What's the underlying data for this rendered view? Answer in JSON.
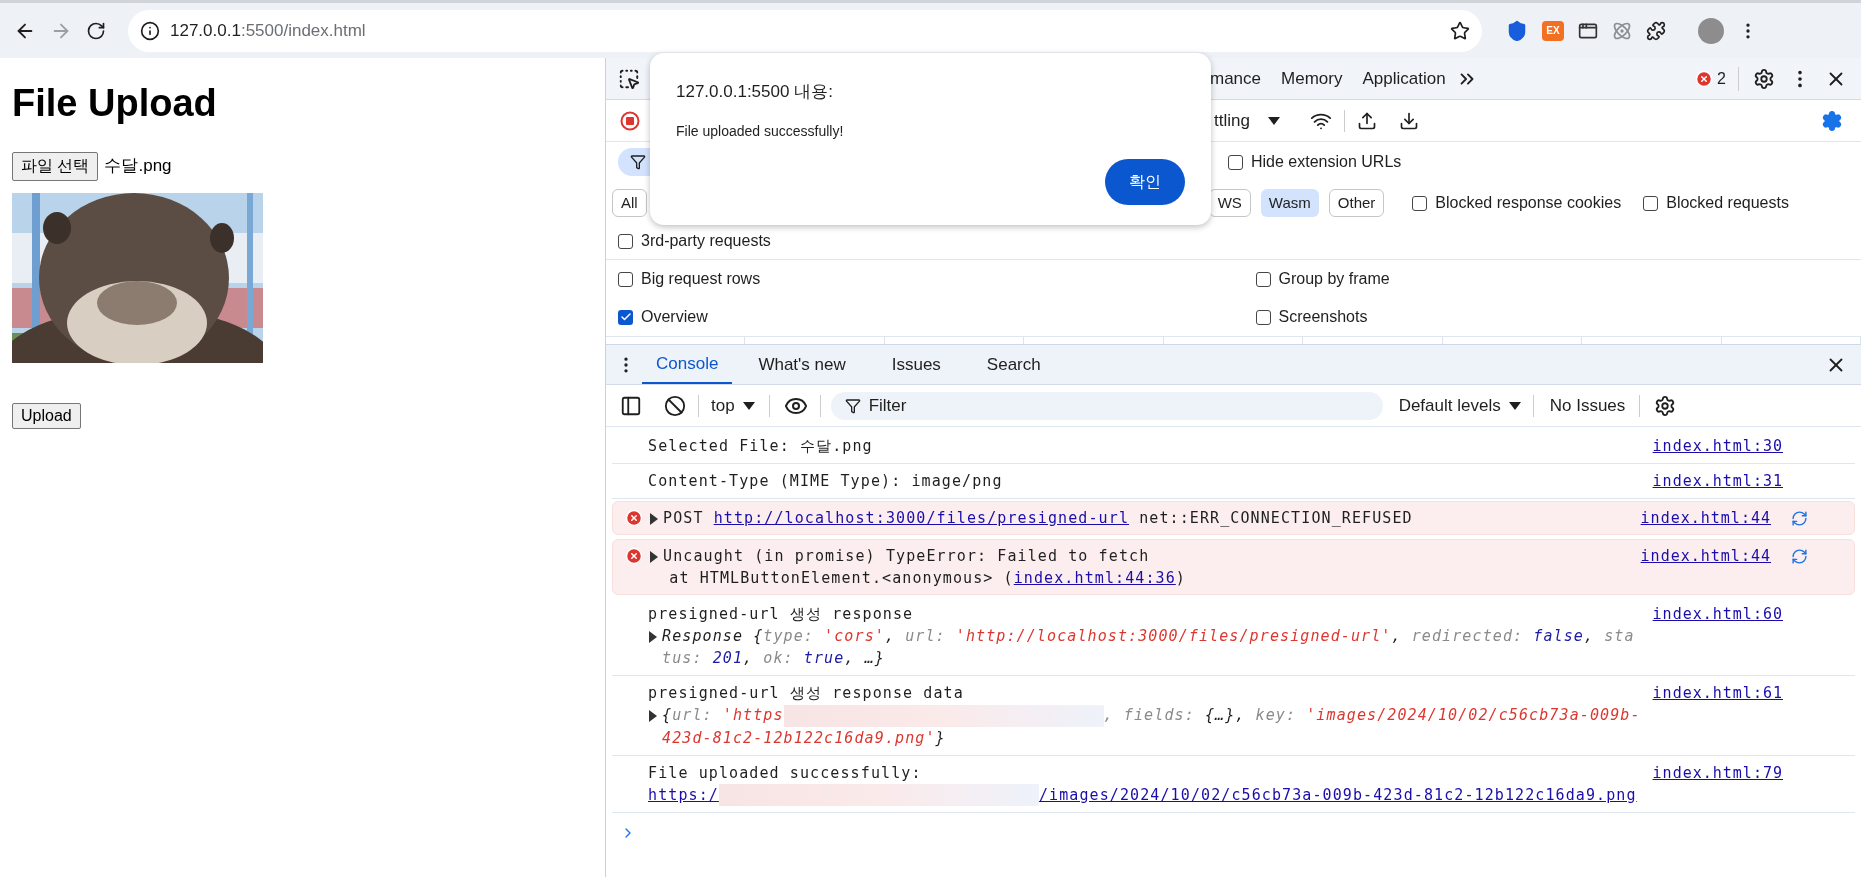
{
  "browser": {
    "url_host": "127.0.0.1",
    "url_path": ":5500/index.html",
    "forward_disabled": true,
    "bookmarked": false,
    "extension_badge": "EX"
  },
  "page": {
    "heading": "File Upload",
    "file_button": "파일 선택",
    "file_name": "수달.png",
    "upload_button": "Upload"
  },
  "dialog": {
    "title": "127.0.0.1:5500 내용:",
    "message": "File uploaded successfully!",
    "button": "확인"
  },
  "devtools": {
    "tabs": [
      "mance",
      "Memory",
      "Application"
    ],
    "error_count": "2",
    "throttling": "ttling",
    "hide_extension_urls": {
      "label": "Hide extension URLs",
      "checked": false
    },
    "type_filters": [
      {
        "label": "All",
        "selected": false
      },
      {
        "label": "WS",
        "selected": false
      },
      {
        "label": "Wasm",
        "selected": true
      },
      {
        "label": "Other",
        "selected": false
      }
    ],
    "type_options": [
      {
        "label": "Blocked response cookies",
        "checked": false
      },
      {
        "label": "Blocked requests",
        "checked": false
      }
    ],
    "third_party": {
      "label": "3rd-party requests",
      "checked": false
    },
    "settings": [
      {
        "label": "Big request rows",
        "checked": false
      },
      {
        "label": "Group by frame",
        "checked": false
      },
      {
        "label": "Overview",
        "checked": true
      },
      {
        "label": "Screenshots",
        "checked": false
      }
    ],
    "drawer_tabs": [
      {
        "label": "Console",
        "selected": true
      },
      {
        "label": "What's new",
        "selected": false
      },
      {
        "label": "Issues",
        "selected": false
      },
      {
        "label": "Search",
        "selected": false
      }
    ],
    "console_toolbar": {
      "context": "top",
      "filter_placeholder": "Filter",
      "levels": "Default levels",
      "issues": "No Issues"
    },
    "messages": [
      {
        "kind": "log",
        "source": "index.html:30",
        "lines": [
          {
            "expandable": false,
            "segments": [
              {
                "kind": "plain",
                "text": "Selected File: 수달.png"
              }
            ]
          }
        ]
      },
      {
        "kind": "log",
        "source": "index.html:31",
        "lines": [
          {
            "expandable": false,
            "segments": [
              {
                "kind": "plain",
                "text": "Content-Type (MIME Type): image/png"
              }
            ]
          }
        ]
      },
      {
        "kind": "error",
        "source": "index.html:44",
        "lines": [
          {
            "expandable": true,
            "segments": [
              {
                "kind": "plain",
                "text": "POST "
              },
              {
                "kind": "link",
                "text": "http://localhost:3000/files/presigned-url"
              },
              {
                "kind": "plain",
                "text": " net::ERR_CONNECTION_REFUSED"
              }
            ]
          }
        ]
      },
      {
        "kind": "error",
        "source": "index.html:44",
        "lines": [
          {
            "expandable": true,
            "segments": [
              {
                "kind": "plain",
                "text": "Uncaught (in promise) TypeError: Failed to fetch"
              }
            ]
          },
          {
            "expandable": false,
            "segments": [
              {
                "kind": "plain",
                "text": "  at HTMLButtonElement.<anonymous> ("
              },
              {
                "kind": "link",
                "text": "index.html:44:36"
              },
              {
                "kind": "plain",
                "text": ")"
              }
            ]
          }
        ]
      },
      {
        "kind": "log",
        "source": "index.html:60",
        "lines": [
          {
            "expandable": false,
            "segments": [
              {
                "kind": "plain",
                "text": "presigned-url 생성 response"
              }
            ]
          },
          {
            "expandable": true,
            "segments": [
              {
                "kind": "obj",
                "text": "Response {"
              },
              {
                "kind": "key",
                "text": "type: "
              },
              {
                "kind": "str",
                "text": "'cors'"
              },
              {
                "kind": "obj",
                "text": ", "
              },
              {
                "kind": "key",
                "text": "url: "
              },
              {
                "kind": "str",
                "text": "'http://localhost:3000/files/presigned-url'"
              },
              {
                "kind": "obj",
                "text": ", "
              },
              {
                "kind": "key",
                "text": "redirected: "
              },
              {
                "kind": "val",
                "text": "false"
              },
              {
                "kind": "obj",
                "text": ", "
              },
              {
                "kind": "key",
                "text": "status: "
              },
              {
                "kind": "val",
                "text": "201"
              },
              {
                "kind": "obj",
                "text": ", "
              },
              {
                "kind": "key",
                "text": "ok: "
              },
              {
                "kind": "val",
                "text": "true"
              },
              {
                "kind": "obj",
                "text": ", …}"
              }
            ]
          }
        ]
      },
      {
        "kind": "log",
        "source": "index.html:61",
        "lines": [
          {
            "expandable": false,
            "segments": [
              {
                "kind": "plain",
                "text": "presigned-url 생성 response data"
              }
            ]
          },
          {
            "expandable": true,
            "segments": [
              {
                "kind": "obj",
                "text": "{"
              },
              {
                "kind": "key",
                "text": "url: "
              },
              {
                "kind": "str",
                "text": "'https"
              },
              {
                "kind": "redacted"
              },
              {
                "kind": "key",
                "text": ", fields: "
              },
              {
                "kind": "obj",
                "text": "{…}"
              },
              {
                "kind": "obj",
                "text": ", "
              },
              {
                "kind": "key",
                "text": "key: "
              },
              {
                "kind": "str",
                "text": "'images/2024/10/02/c56cb73a-009b-423d-81c2-12b122c16da9.png'"
              },
              {
                "kind": "obj",
                "text": "}"
              }
            ]
          }
        ]
      },
      {
        "kind": "log",
        "source": "index.html:79",
        "lines": [
          {
            "expandable": false,
            "segments": [
              {
                "kind": "plain",
                "text": "File uploaded successfully:"
              }
            ]
          },
          {
            "expandable": false,
            "segments": [
              {
                "kind": "link",
                "text": "https:/"
              },
              {
                "kind": "redacted"
              },
              {
                "kind": "link",
                "text": "/images/2024/10/02/c56cb73a-009b-423d-81c2-12b122c16da9.png"
              }
            ]
          }
        ]
      }
    ]
  }
}
